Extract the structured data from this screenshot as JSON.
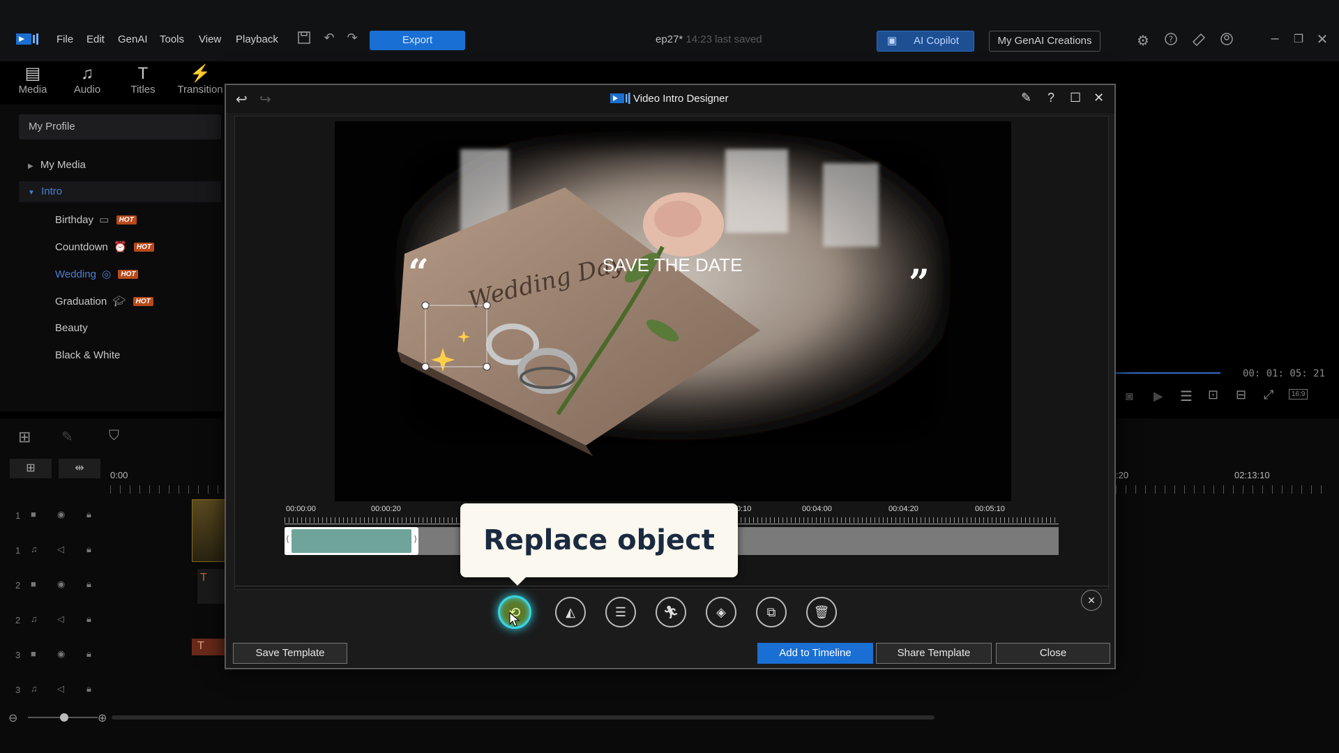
{
  "menu": {
    "items": [
      "File",
      "Edit",
      "GenAI",
      "Tools",
      "View",
      "Playback"
    ],
    "export_label": "Export",
    "project_name": "ep27*",
    "project_status": "14:23 last saved",
    "ai_copilot_label": "AI Copilot",
    "genai_creations_label": "My GenAI Creations"
  },
  "modules": {
    "media": "Media",
    "audio": "Audio",
    "titles": "Titles",
    "transition": "Transition"
  },
  "library": {
    "profile_label": "My Profile",
    "my_media": "My Media",
    "intro": "Intro",
    "categories": [
      {
        "label": "Birthday",
        "hot": "HOT"
      },
      {
        "label": "Countdown",
        "hot": "HOT"
      },
      {
        "label": "Wedding",
        "hot": "HOT"
      },
      {
        "label": "Graduation",
        "hot": "HOT"
      },
      {
        "label": "Beauty",
        "hot": ""
      },
      {
        "label": "Black & White",
        "hot": ""
      }
    ]
  },
  "preview": {
    "timecode": "00: 01: 05: 21",
    "ratio": "16:9"
  },
  "timeline": {
    "start_time": "0:00",
    "right_time_a": ":20",
    "right_time_b": "02:13:10",
    "tracks": [
      "1",
      "1",
      "2",
      "2",
      "3",
      "3"
    ]
  },
  "dialog": {
    "title": "Video Intro Designer",
    "overlay_text": "SAVE THE DATE",
    "quote_open": "“",
    "quote_close": "”",
    "ruler": [
      "00:00:00",
      "00:00:20",
      "0:10",
      "00:04:00",
      "00:04:20",
      "00:05:10"
    ],
    "tooltip": "Replace object",
    "save_template": "Save Template",
    "add_to_timeline": "Add to Timeline",
    "share_template": "Share Template",
    "close": "Close"
  },
  "colors": {
    "accent_blue": "#1a6fd4",
    "hot_badge": "#b84a1b",
    "clip_teal": "#6fa49a",
    "wedding_highlight": "#4a7fd4",
    "glow_cyan": "#39d6e6"
  }
}
